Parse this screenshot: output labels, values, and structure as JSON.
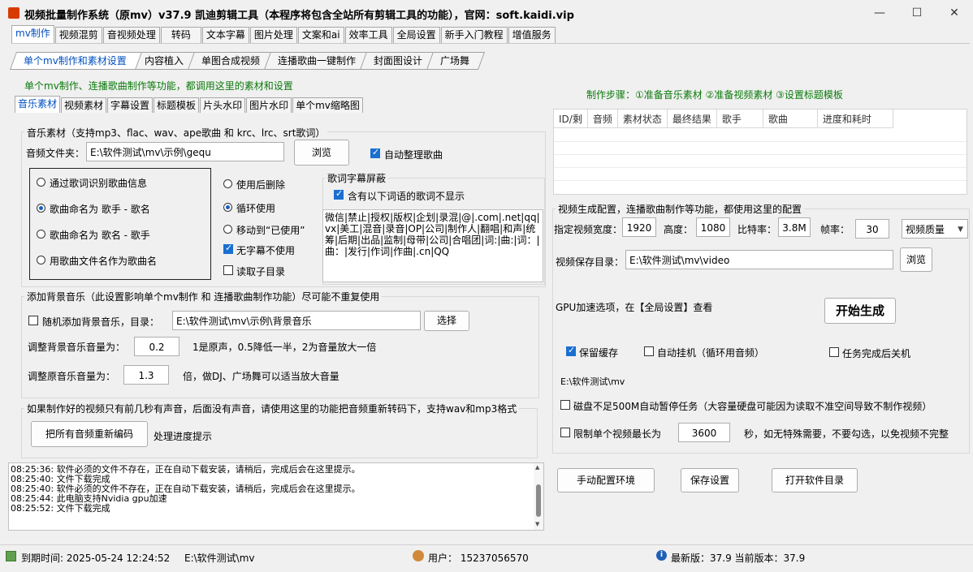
{
  "window": {
    "title": "视频批量制作系统（原mv）v37.9     凯迪剪辑工具（本程序将包含全站所有剪辑工具的功能），官网：soft.kaidi.vip",
    "minimize": "—",
    "maximize": "☐",
    "close": "✕"
  },
  "main_tabs": [
    "mv制作",
    "视频混剪",
    "音视频处理",
    "转码",
    "文本字幕",
    "图片处理",
    "文案和ai",
    "效率工具",
    "全局设置",
    "新手入门教程",
    "增值服务"
  ],
  "sub_tabs": [
    "单个mv制作和素材设置",
    "内容植入",
    "单图合成视频",
    "连播歌曲一键制作",
    "封面图设计",
    "广场舞"
  ],
  "intro_text": "单个mv制作、连播歌曲制作等功能，都调用这里的素材和设置",
  "steps_text": "制作步骤：①准备音乐素材 ②准备视频素材  ③设置标题模板",
  "inner_tabs": [
    "音乐素材",
    "视频素材",
    "字幕设置",
    "标题模板",
    "片头水印",
    "图片水印",
    "单个mv缩略图"
  ],
  "music": {
    "legend": "音乐素材（支持mp3、flac、wav、ape歌曲 和 krc、lrc、srt歌词）",
    "folder_label": "音频文件夹：",
    "folder_value": "E:\\软件测试\\mv\\示例\\gequ",
    "browse": "浏览",
    "auto_organize": "自动整理歌曲",
    "naming_options": [
      "通过歌词识别歌曲信息",
      "歌曲命名为    歌手 - 歌名",
      "歌曲命名为    歌名 - 歌手",
      "用歌曲文件名作为歌曲名"
    ],
    "after_options": [
      "使用后删除",
      "循环使用",
      "移动到“已使用”"
    ],
    "no_sub_unused": "无字幕不使用",
    "read_subdir": "读取子目录"
  },
  "lyric_mask": {
    "legend": "歌词字幕屏蔽",
    "checkbox": "含有以下词语的歌词不显示",
    "words": "微信|禁止|授权|版权|企划|录混|@|.com|.net|qq|vx|美工|混音|录音|OP|公司|制作人|翻唱|和声|统筹|后期|出品|监制|母带|公司|合唱团|词:|曲:|词：|曲：|发行|作词|作曲|.cn|QQ"
  },
  "bgm": {
    "legend": "添加背景音乐（此设置影响单个mv制作 和 连播歌曲制作功能）尽可能不重复使用",
    "random_label": "随机添加背景音乐，目录：",
    "dir_value": "E:\\软件测试\\mv\\示例\\背景音乐",
    "select": "选择",
    "bg_vol_label": "调整背景音乐音量为：",
    "bg_vol": "0.2",
    "bg_vol_hint": "1是原声，0.5降低一半，2为音量放大一倍",
    "orig_vol_label": "调整原音乐音量为：",
    "orig_vol": "1.3",
    "orig_vol_hint": "倍，做DJ、广场舞可以适当放大音量"
  },
  "reencode": {
    "legend": "如果制作好的视频只有前几秒有声音，后面没有声音，请使用这里的功能把音频重新转码下，支持wav和mp3格式",
    "button": "把所有音频重新编码",
    "progress": "处理进度提示"
  },
  "log": [
    {
      "time": "08:25:36:",
      "msg": "软件必须的文件不存在，正在自动下载安装，请稍后，完成后会在这里提示。"
    },
    {
      "time": "08:25:40:",
      "msg": "文件下载完成"
    },
    {
      "time": "08:25:40:",
      "msg": "软件必须的文件不存在，正在自动下载安装，请稍后，完成后会在这里提示。"
    },
    {
      "time": "08:25:44:",
      "msg": "此电脑支持Nvidia gpu加速"
    },
    {
      "time": "08:25:52:",
      "msg": "文件下载完成"
    }
  ],
  "task_table": {
    "columns": [
      "ID/剩",
      "音频",
      "素材状态",
      "最终结果",
      "歌手",
      "歌曲",
      "进度和耗时"
    ]
  },
  "video_config": {
    "legend": "视频生成配置，连播歌曲制作等功能，都使用这里的配置",
    "width_label": "指定视频宽度：",
    "width": "1920",
    "height_label": "高度：",
    "height": "1080",
    "bitrate_label": "比特率：",
    "bitrate": "3.8M",
    "fps_label": "帧率：",
    "fps": "30",
    "quality": "视频质量",
    "save_label": "视频保存目录：",
    "save_dir": "E:\\软件测试\\mv\\video",
    "browse": "浏览",
    "gpu_hint": "GPU加速选项，在【全局设置】查看",
    "start": "开始生成",
    "keep_cache": "保留缓存",
    "auto_hang": "自动挂机（循环用音频）",
    "shutdown": "任务完成后关机",
    "path": "E:\\软件测试\\mv",
    "disk_pause": "磁盘不足500M自动暂停任务（大容量硬盘可能因为读取不准空间导致不制作视频）",
    "limit_label": "限制单个视频最长为",
    "limit_value": "3600",
    "limit_hint": "秒，如无特殊需要，不要勾选，以免视频不完整"
  },
  "bottom_buttons": [
    "手动配置环境",
    "保存设置",
    "打开软件目录"
  ],
  "status": {
    "expire": "到期时间:  2025-05-24 12:24:52",
    "expire_path": "E:\\软件测试\\mv",
    "user": "用户： 15237056570",
    "version": "最新版：37.9  当前版本：37.9"
  }
}
